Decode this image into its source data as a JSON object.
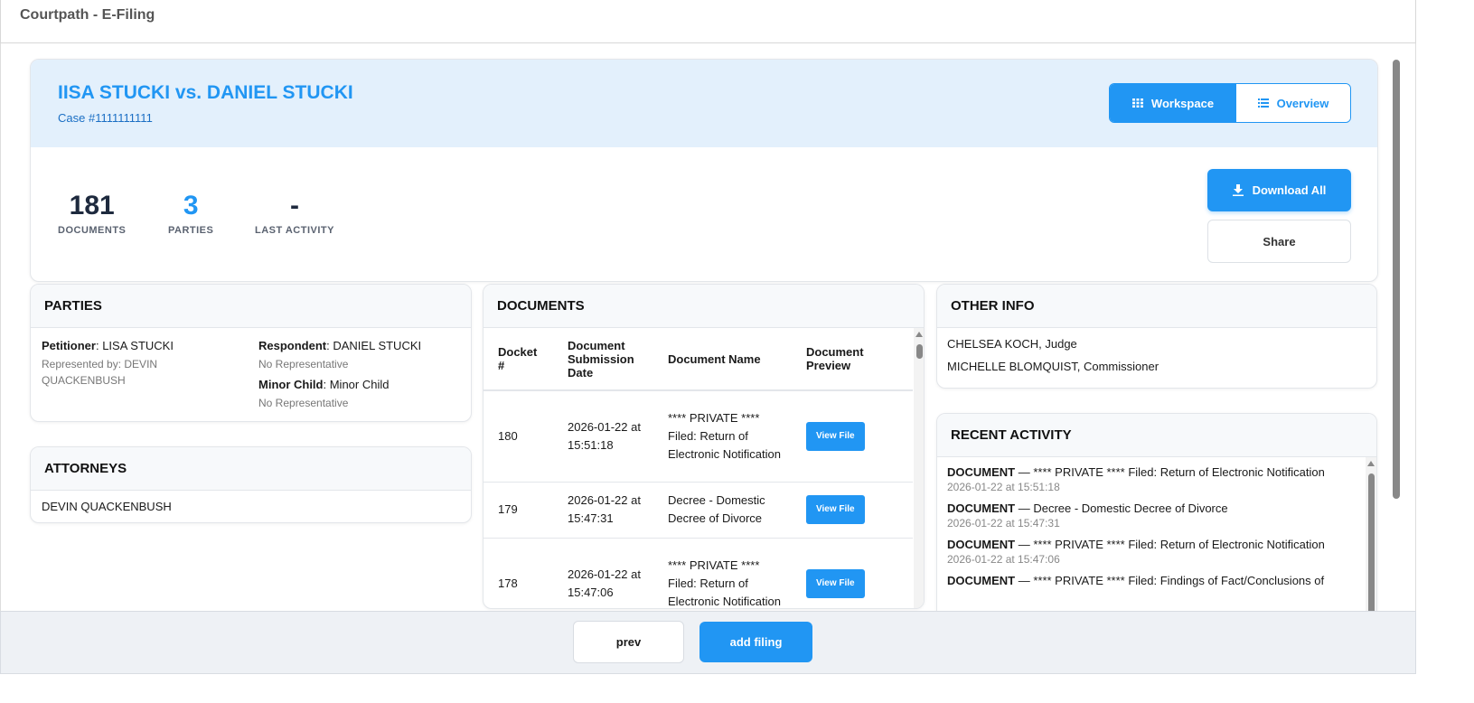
{
  "app": {
    "title": "Courtpath - E-Filing"
  },
  "case": {
    "title": "IISA STUCKI vs. DANIEL STUCKI",
    "number": "Case #1111111111"
  },
  "view_toggle": {
    "workspace": "Workspace",
    "overview": "Overview",
    "active": "workspace"
  },
  "stats": [
    {
      "value": "181",
      "label": "DOCUMENTS"
    },
    {
      "value": "3",
      "label": "PARTIES"
    },
    {
      "value": "-",
      "label": "LAST ACTIVITY"
    }
  ],
  "actions": {
    "download_all": "Download All",
    "share": "Share"
  },
  "parties": {
    "heading": "PARTIES",
    "petitioner": {
      "role": "Petitioner",
      "name": ": LISA STUCKI",
      "rep": "Represented by: DEVIN QUACKENBUSH"
    },
    "respondent": {
      "role": "Respondent",
      "name": ": DANIEL STUCKI",
      "rep": "No Representative"
    },
    "minor": {
      "role": "Minor Child",
      "name": ": Minor Child",
      "rep": "No Representative"
    }
  },
  "attorneys": {
    "heading": "ATTORNEYS",
    "items": [
      "DEVIN QUACKENBUSH"
    ]
  },
  "documents": {
    "heading": "DOCUMENTS",
    "columns": [
      "Docket #",
      "Document Submission Date",
      "Document Name",
      "Document Preview"
    ],
    "view_label": "View File",
    "rows": [
      {
        "docket": "180",
        "date": "2026-01-22 at 15:51:18",
        "name": "**** PRIVATE **** Filed: Return of Electronic Notification"
      },
      {
        "docket": "179",
        "date": "2026-01-22 at 15:47:31",
        "name": "Decree - Domestic Decree of Divorce"
      },
      {
        "docket": "178",
        "date": "2026-01-22 at 15:47:06",
        "name": "**** PRIVATE **** Filed: Return of Electronic Notification"
      }
    ]
  },
  "other_info": {
    "heading": "OTHER INFO",
    "items": [
      "CHELSEA KOCH, Judge",
      "MICHELLE BLOMQUIST, Commissioner"
    ]
  },
  "recent_activity": {
    "heading": "RECENT ACTIVITY",
    "items": [
      {
        "type": "DOCUMENT",
        "text": " — **** PRIVATE **** Filed: Return of Electronic Notification",
        "time": "2026-01-22 at 15:51:18"
      },
      {
        "type": "DOCUMENT",
        "text": " — Decree - Domestic Decree of Divorce",
        "time": "2026-01-22 at 15:47:31"
      },
      {
        "type": "DOCUMENT",
        "text": " — **** PRIVATE **** Filed: Return of Electronic Notification",
        "time": "2026-01-22 at 15:47:06"
      },
      {
        "type": "DOCUMENT",
        "text": " — **** PRIVATE **** Filed: Findings of Fact/Conclusions of",
        "time": ""
      }
    ]
  },
  "footer": {
    "prev": "prev",
    "add_filing": "add filing"
  },
  "colors": {
    "accent": "#2196f3",
    "hero_bg": "#e3f0fc"
  }
}
